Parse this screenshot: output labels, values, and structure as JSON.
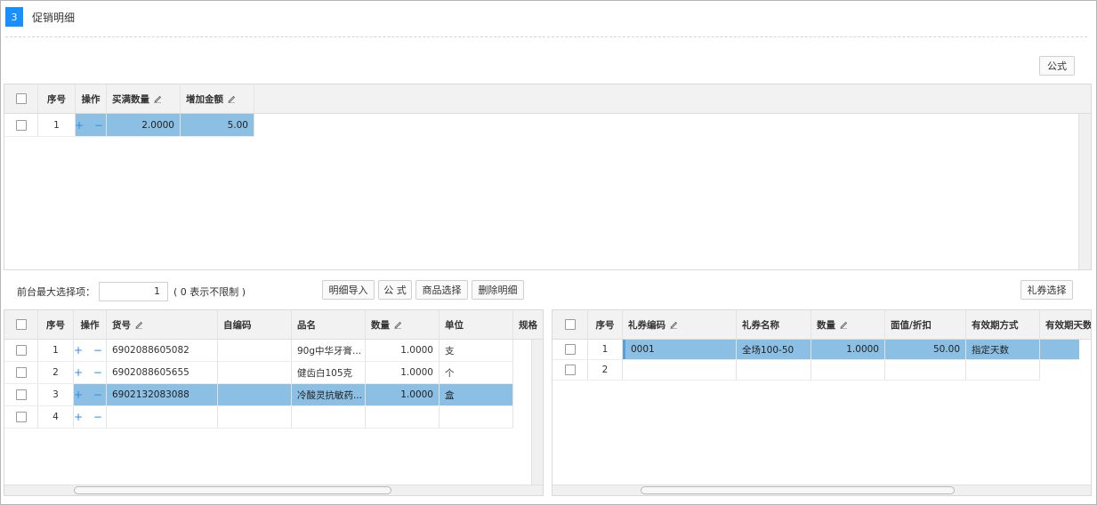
{
  "section": {
    "number": "3",
    "title": "促销明细"
  },
  "top": {
    "formula_button": "公式",
    "columns": [
      "序号",
      "操作",
      "买满数量",
      "增加金额"
    ],
    "rows": [
      {
        "seq": "1",
        "ops": "+ −",
        "qty": "2.0000",
        "amount": "5.00"
      }
    ]
  },
  "max_select": {
    "label": "前台最大选择项：",
    "value": "1",
    "hint": "( 0 表示不限制 )"
  },
  "toolbar": {
    "import_label": "明细导入",
    "formula_label": "公 式",
    "product_select_label": "商品选择",
    "delete_label": "删除明细",
    "coupon_select_label": "礼券选择"
  },
  "products": {
    "columns": [
      "序号",
      "操作",
      "货号",
      "自编码",
      "品名",
      "数量",
      "单位",
      "规格"
    ],
    "rows": [
      {
        "seq": "1",
        "ops": "+ −",
        "code": "6902088605082",
        "self_code": "",
        "name": "90g中华牙膏...",
        "qty": "1.0000",
        "unit": "支"
      },
      {
        "seq": "2",
        "ops": "+ −",
        "code": "6902088605655",
        "self_code": "",
        "name": "健齿白105克",
        "qty": "1.0000",
        "unit": "个"
      },
      {
        "seq": "3",
        "ops": "+ −",
        "code": "6902132083088",
        "self_code": "",
        "name": "冷酸灵抗敏药...",
        "qty": "1.0000",
        "unit": "盒"
      },
      {
        "seq": "4",
        "ops": "+ −",
        "code": "",
        "self_code": "",
        "name": "",
        "qty": "",
        "unit": ""
      }
    ]
  },
  "coupons": {
    "columns": [
      "序号",
      "礼券编码",
      "礼券名称",
      "数量",
      "面值/折扣",
      "有效期方式",
      "有效期天数"
    ],
    "rows": [
      {
        "seq": "1",
        "code": "0001",
        "name": "全场100-50",
        "qty": "1.0000",
        "value": "50.00",
        "mode": "指定天数"
      },
      {
        "seq": "2",
        "code": "",
        "name": "",
        "qty": "",
        "value": "",
        "mode": ""
      }
    ]
  },
  "colors": {
    "accent": "#1890ff",
    "selected_row": "#8bbfe3",
    "op_icon": "#2d8ceb"
  }
}
